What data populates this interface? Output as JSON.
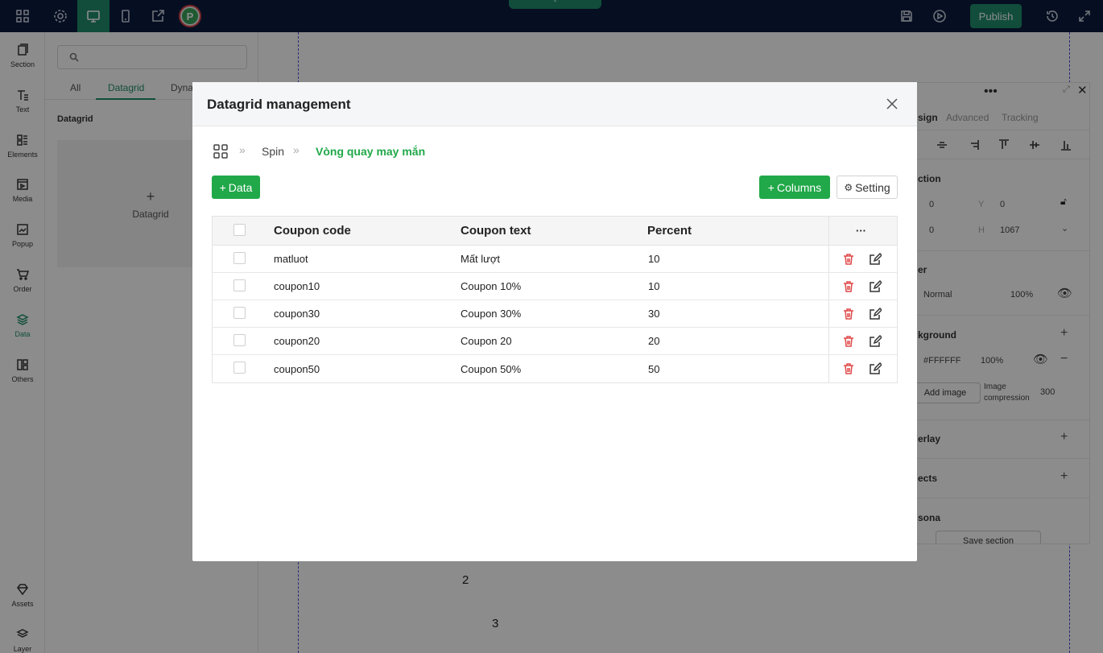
{
  "topbar": {
    "publish_label": "Publish",
    "avatar_letter": "P"
  },
  "rail": {
    "items": [
      {
        "label": "Section"
      },
      {
        "label": "Text"
      },
      {
        "label": "Elements"
      },
      {
        "label": "Media"
      },
      {
        "label": "Popup"
      },
      {
        "label": "Order"
      },
      {
        "label": "Data"
      },
      {
        "label": "Others"
      },
      {
        "label": "Assets"
      },
      {
        "label": "Layer"
      }
    ]
  },
  "panel": {
    "tabs": [
      "All",
      "Datagrid",
      "Dyna"
    ],
    "heading": "Datagrid",
    "card_label": "Datagrid"
  },
  "canvas": {
    "numbers": [
      "2",
      "3"
    ]
  },
  "design_panel": {
    "tabs": [
      "sign",
      "Advanced",
      "Tracking"
    ],
    "position_title": "ction",
    "x_value": "0",
    "y_key": "Y",
    "y_value": "0",
    "w_value": "0",
    "h_key": "H",
    "h_value": "1067",
    "layer_title": "er",
    "blend_mode": "Normal",
    "opacity": "100%",
    "background_title": "kground",
    "bg_color": "#FFFFFF",
    "bg_opacity": "100%",
    "add_image_label": "Add image",
    "compression_label": "Image compression",
    "compression_value": "300",
    "overlay_title": "erlay",
    "effects_title": "ects",
    "persona_title": "sona",
    "save_section_label": "Save section"
  },
  "modal": {
    "title": "Datagrid management",
    "breadcrumb": {
      "level1": "Spin",
      "level2": "Vòng quay may mắn"
    },
    "add_data_label": "Data",
    "columns_label": "Columns",
    "setting_label": "Setting",
    "table": {
      "headers": [
        "Coupon code",
        "Coupon text",
        "Percent"
      ],
      "actions_header": "···",
      "rows": [
        [
          "matluot",
          "Mất lượt",
          "10"
        ],
        [
          "coupon10",
          "Coupon 10%",
          "10"
        ],
        [
          "coupon30",
          "Coupon 30%",
          "30"
        ],
        [
          "coupon20",
          "Coupon 20",
          "20"
        ],
        [
          "coupon50",
          "Coupon 50%",
          "50"
        ]
      ]
    }
  },
  "colors": {
    "topbar": "#0b1b3f",
    "accent": "#1f8d6a",
    "green_button": "#21a849",
    "delete": "#e04848",
    "breadcrumb_active": "#21a849"
  }
}
